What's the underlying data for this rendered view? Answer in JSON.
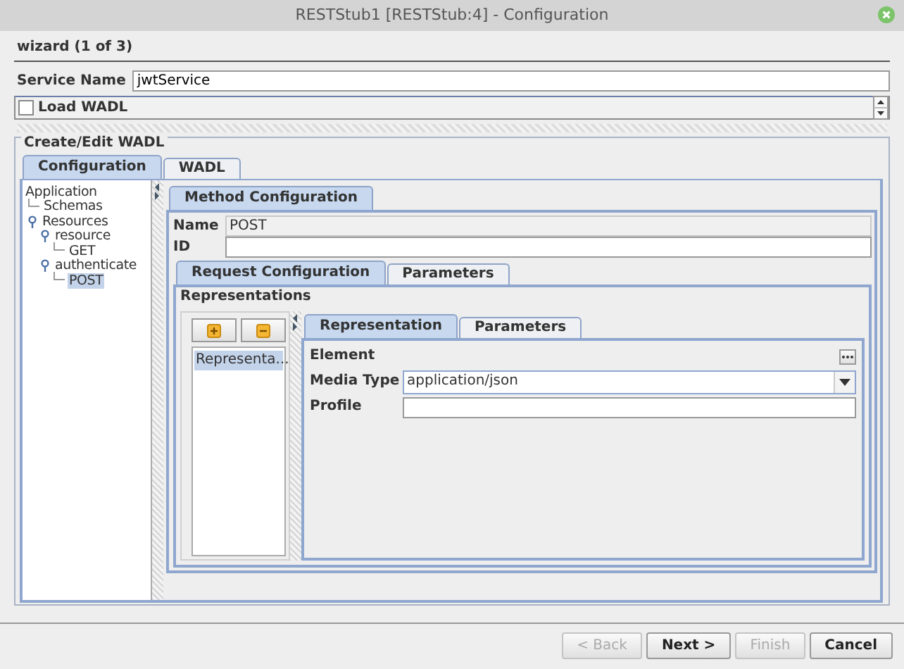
{
  "window": {
    "title": "RESTStub1 [RESTStub:4] - Configuration"
  },
  "wizard_heading": "wizard (1 of 3)",
  "service_name": {
    "label": "Service Name",
    "value": "jwtService"
  },
  "load_wadl": {
    "label": "Load WADL",
    "checked": false
  },
  "group": {
    "title": "Create/Edit WADL"
  },
  "tabs": [
    {
      "label": "Configuration",
      "selected": true
    },
    {
      "label": "WADL",
      "selected": false
    }
  ],
  "tree": [
    {
      "label": "Application",
      "selected": false,
      "children": [
        {
          "label": "Schemas",
          "selected": false
        },
        {
          "label": "Resources",
          "selected": false,
          "expanded": true,
          "children": [
            {
              "label": "resource",
              "selected": false,
              "expanded": true,
              "children": [
                {
                  "label": "GET",
                  "selected": false
                }
              ]
            },
            {
              "label": "authenticate",
              "selected": false,
              "expanded": true,
              "children": [
                {
                  "label": "POST",
                  "selected": true
                }
              ]
            }
          ]
        }
      ]
    }
  ],
  "method": {
    "tab": "Method Configuration",
    "name_label": "Name",
    "name_value": "POST",
    "id_label": "ID"
  },
  "request_tabs": [
    {
      "label": "Request Configuration",
      "selected": true
    },
    {
      "label": "Parameters",
      "selected": false
    }
  ],
  "representations": {
    "title": "Representations",
    "items": [
      {
        "label": "Representa...",
        "selected": true
      }
    ]
  },
  "rep_tabs": [
    {
      "label": "Representation",
      "selected": true
    },
    {
      "label": "Parameters",
      "selected": false
    }
  ],
  "fields": [
    {
      "kind": "button",
      "label": "Element"
    },
    {
      "kind": "combo",
      "label": "Media Type",
      "value": "application/json"
    },
    {
      "kind": "text",
      "label": "Profile"
    }
  ],
  "buttons": [
    {
      "label": "< Back",
      "disabled": true
    },
    {
      "label": "Next >",
      "disabled": false
    },
    {
      "label": "Finish",
      "disabled": true
    },
    {
      "label": "Cancel",
      "disabled": false
    }
  ]
}
